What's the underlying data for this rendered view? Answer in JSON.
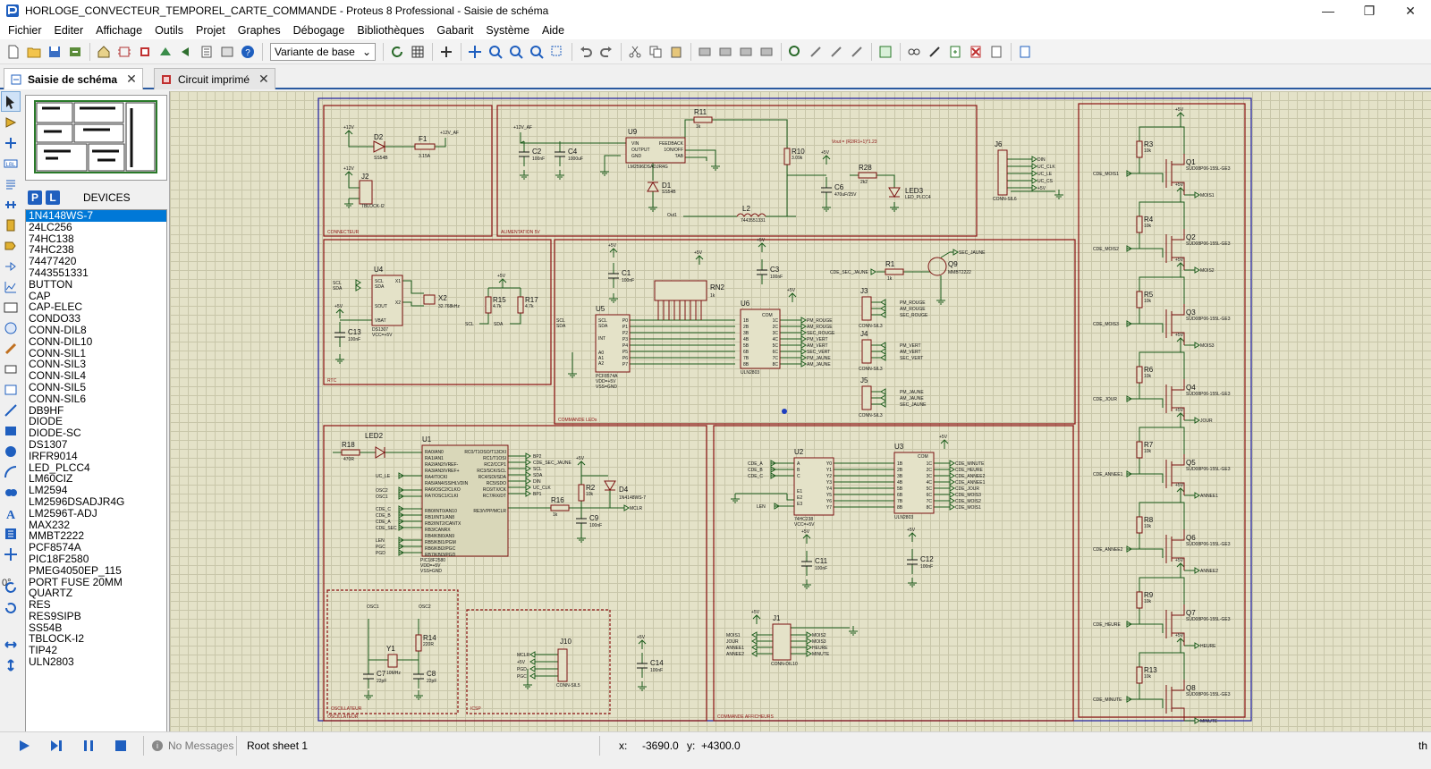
{
  "window": {
    "title": "HORLOGE_CONVECTEUR_TEMPOREL_CARTE_COMMANDE - Proteus 8 Professional - Saisie de schéma",
    "minimize": "—",
    "maximize": "❐",
    "close": "✕"
  },
  "menu": [
    "Fichier",
    "Editer",
    "Affichage",
    "Outils",
    "Projet",
    "Graphes",
    "Débogage",
    "Bibliothèques",
    "Gabarit",
    "Système",
    "Aide"
  ],
  "toolbar": {
    "variant_label": "Variante de base"
  },
  "tabs": [
    {
      "label": "Saisie de schéma",
      "active": true
    },
    {
      "label": "Circuit imprimé",
      "active": false
    }
  ],
  "devices": {
    "p_label": "P",
    "l_label": "L",
    "title": "DEVICES",
    "selected": "1N4148WS-7",
    "items": [
      "1N4148WS-7",
      "24LC256",
      "74HC138",
      "74HC238",
      "74477420",
      "7443551331",
      "BUTTON",
      "CAP",
      "CAP-ELEC",
      "CONDO33",
      "CONN-DIL8",
      "CONN-DIL10",
      "CONN-SIL1",
      "CONN-SIL3",
      "CONN-SIL4",
      "CONN-SIL5",
      "CONN-SIL6",
      "DB9HF",
      "DIODE",
      "DIODE-SC",
      "DS1307",
      "IRFR9014",
      "LED_PLCC4",
      "LM60CIZ",
      "LM2594",
      "LM2596DSADJR4G",
      "LM2596T-ADJ",
      "MAX232",
      "MMBT2222",
      "PCF8574A",
      "PIC18F2580",
      "PMEG4050EP_115",
      "PORT FUSE 20MM",
      "QUARTZ",
      "RES",
      "RES9SIPB",
      "SS54B",
      "TBLOCK-I2",
      "TIP42",
      "ULN2803"
    ]
  },
  "left_tools": {
    "angle": "0°"
  },
  "schematic": {
    "blocks": [
      "CONNECTEUR",
      "ALIMENTATION 5V",
      "RTC",
      "COMMANDE LEDs",
      "OSCILLATEUR",
      "ICSP",
      "COMMANDE AFFICHEURS"
    ],
    "formula": "Vout = (R2/R1+1)*1.23",
    "components": {
      "D2": "D2",
      "D2_val": "SS54B",
      "F1": "F1",
      "F1_val": "3.15A",
      "J2": "J2",
      "J2_val": "TBLOCK-I2",
      "p12v_a": "+12V",
      "p12v_b": "+12V",
      "p12vaf": "+12V_AF",
      "p12vaf2": "+12V_AF",
      "U9": "U9",
      "U9_val": "LM2596DSADJR4G",
      "U9_vin": "VIN",
      "U9_out": "OUTPUT",
      "U9_gnd": "GND",
      "U9_fb": "FEEDBACK",
      "U9_on": "1ON/OFF",
      "U9_tab": "TAB",
      "C2": "C2",
      "C2_val": "100nF",
      "C4": "C4",
      "C4_val": "1000uF",
      "R11": "R11",
      "R11_val": "1k",
      "R10": "R10",
      "R10_val": "3.09k",
      "D1": "D1",
      "D1_val": "SS54B",
      "L2": "L2",
      "L2_val": "7443551331",
      "C6": "C6",
      "C6_val": "470uF/25V",
      "R28": "R28",
      "R28_val": "2k2",
      "LED3": "LED3",
      "LED3_val": "LED_PLCC4",
      "out1": "Out1",
      "p5v": "+5V",
      "J6": "J6",
      "J6_val": "CONN-SIL6",
      "J6_pins": [
        "DIN",
        "UC_CLK",
        "UC_LE",
        "UC_CS",
        "+5V"
      ],
      "U4": "U4",
      "U4_val": "DS1307",
      "U4_vcc": "VCC=+5V",
      "U4_pins_l": [
        "SCL",
        "SDA",
        "SOUT",
        "VBAT"
      ],
      "U4_pins_r": [
        "X1",
        "X2"
      ],
      "X2": "X2",
      "X2_val": "32.768kHz",
      "R15": "R15",
      "R15_val": "4.7k",
      "R17": "R17",
      "R17_val": "4.7k",
      "C13": "C13",
      "C13_val": "100nF",
      "scl": "SCL",
      "sda": "SDA",
      "U5": "U5",
      "U5_val": "PCF8574A",
      "U5_vdd": "VDD=+5V",
      "U5_vss": "VSS=GND",
      "C1": "C1",
      "C1_val": "100nF",
      "RN2": "RN2",
      "RN2_val": "1k",
      "C3": "C3",
      "C3_val": "100nF",
      "U6": "U6",
      "U6_val": "ULN2803",
      "U6_com": "COM",
      "R1": "R1",
      "R1_val": "1k",
      "Q9": "Q9",
      "Q9_val": "MMBT2222",
      "cde_sec_jaune": "CDE_SEC_JAUNE",
      "sec_jaune": "SEC_JAUNE",
      "J3": "J3",
      "J4": "J4",
      "J5": "J5",
      "conn_sil3": "CONN-SIL3",
      "leds_out": [
        "PM_ROUGE",
        "AM_ROUGE",
        "SEC_ROUGE",
        "PM_VERT",
        "AM_VERT",
        "SEC_VERT",
        "PM_JAUNE",
        "AM_JAUNE"
      ],
      "J3_pins": [
        "PM_ROUGE",
        "AM_ROUGE",
        "SEC_ROUGE"
      ],
      "J4_pins": [
        "PM_VERT",
        "AM_VERT",
        "SEC_VERT"
      ],
      "J5_pins": [
        "PM_JAUNE",
        "AM_JAUNE",
        "SEC_JAUNE"
      ],
      "R18": "R18",
      "R18_val": "470R",
      "LED2": "LED2",
      "U1": "U1",
      "U1_val": "PIC18F2580",
      "U1_vdd": "VDD=+5V",
      "U1_vss": "VSS=GND",
      "U1_pins_l": [
        "RA0/AN0",
        "RA1/AN1",
        "RA2/AN2/VREF-",
        "RA3/AN3/VREF+",
        "RA4/T0CKI",
        "RA5/AN4/SS/HLVDIN",
        "RA6/OSC2/CLKO",
        "RA7/OSC1/CLKI",
        "RB0/INT0/AN10",
        "RB1/INT1/AN8",
        "RB2/INT2/CANTX",
        "RB3/CANRX",
        "RB4/KBI0/AN9",
        "RB5/KBI1/PGM",
        "RB6/KBI2/PGC",
        "RB7/KBI3/PGD"
      ],
      "U1_pins_r": [
        "RC0/T1OSO/T13CKI",
        "RC1/T1OSI",
        "RC2/CCP1",
        "RC3/SCK/SCL",
        "RC4/SDI/SDA",
        "RC5/SDO",
        "RC6/TX/CK",
        "RC7/RX/DT",
        "RE3/VPP/MCLR"
      ],
      "U1_nets_l": [
        "LED",
        "UC_LE",
        "OSC2",
        "OSC1",
        "CDE_C",
        "CDE_B",
        "CDE_A",
        "CDE_SEC",
        "LEN",
        "PGC",
        "PGD"
      ],
      "U1_nets_r": [
        "BP2",
        "CDE_SEC_JAUNE",
        "SCL",
        "SDA",
        "DIN",
        "UC_CLK",
        "BP1"
      ],
      "R2": "R2",
      "R2_val": "10k",
      "D4": "D4",
      "D4_val": "1N4148WS-7",
      "R16": "R16",
      "R16_val": "1k",
      "C9": "C9",
      "C9_val": "100nF",
      "mclr": "MCLR",
      "osc1": "OSC1",
      "osc2": "OSC2",
      "Y1": "Y1",
      "Y1_val": "10MHz",
      "R14": "R14",
      "R14_val": "220R",
      "C7": "C7",
      "C7_val": "22pF",
      "C8": "C8",
      "C8_val": "22pF",
      "J10": "J10",
      "J10_val": "CONN-SIL5",
      "J10_pins": [
        "MCLR",
        "+5V",
        "PGD",
        "PGC"
      ],
      "C14": "C14",
      "C14_val": "100nF",
      "U2": "U2",
      "U2_val": "74HC238",
      "U2_vcc": "VCC=+5V",
      "U2_pins": [
        "A",
        "B",
        "C",
        "E1",
        "E2",
        "E3"
      ],
      "U2_out": [
        "Y0",
        "Y1",
        "Y2",
        "Y3",
        "Y4",
        "Y5",
        "Y6",
        "Y7"
      ],
      "U2_nets": [
        "CDE_A",
        "CDE_B",
        "CDE_C",
        "LEN"
      ],
      "U3": "U3",
      "U3_val": "ULN2803",
      "U3_nets": [
        "CDE_MINUTE",
        "CDE_HEURE",
        "CDE_ANNEE2",
        "CDE_ANNEE1",
        "CDE_JOUR",
        "CDE_MOIS3",
        "CDE_MOIS2",
        "CDE_MOIS1"
      ],
      "C11": "C11",
      "C11_val": "100nF",
      "C12": "C12",
      "C12_val": "100nF",
      "J1": "J1",
      "J1_val": "CONN-DIL10",
      "J1_l": [
        "MOIS1",
        "JOUR",
        "ANNEE1",
        "ANNEE2"
      ],
      "J1_r": [
        "MOIS2",
        "MOIS3",
        "HEURE",
        "MINUTE"
      ],
      "mosfet_val": "SUD08P06-155L-GE3",
      "right_r": [
        "R3",
        "R4",
        "R5",
        "R6",
        "R7",
        "R8",
        "R9",
        "R13"
      ],
      "right_q": [
        "Q1",
        "Q2",
        "Q3",
        "Q4",
        "Q5",
        "Q6",
        "Q7",
        "Q8"
      ],
      "right_cde": [
        "CDE_MOIS1",
        "CDE_MOIS2",
        "CDE_MOIS3",
        "CDE_JOUR",
        "CDE_ANNEE1",
        "CDE_ANNEE2",
        "CDE_HEURE",
        "CDE_MINUTE"
      ],
      "right_out": [
        "MOIS1",
        "MOIS2",
        "MOIS3",
        "JOUR",
        "ANNEE1",
        "ANNEE2",
        "HEURE",
        "MINUTE"
      ],
      "r10k": "10k"
    }
  },
  "status": {
    "messages": "No Messages",
    "sheet": "Root sheet 1",
    "x_label": "x:",
    "x_value": "-3690.0",
    "y_label": "y:",
    "y_value": "+4300.0",
    "units": "th"
  }
}
